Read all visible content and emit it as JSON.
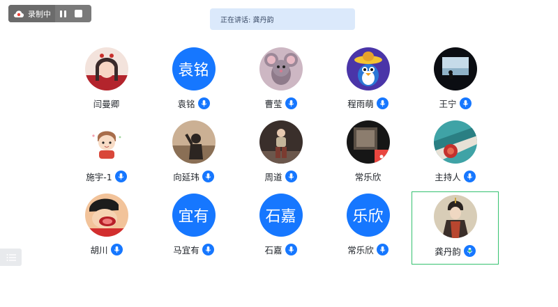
{
  "recording": {
    "label": "录制中",
    "icons": [
      "cloud-record-icon",
      "pause-icon",
      "stop-icon"
    ]
  },
  "speaking": {
    "text": "正在讲话: 龚丹韵"
  },
  "accent_color": "#1677ff",
  "active_border_color": "#34c16f",
  "participants": [
    {
      "name": "闫曼卿",
      "avatar": "photo",
      "mic": false
    },
    {
      "name": "袁铭",
      "avatar_text": "袁铭",
      "avatar": "text",
      "mic": true
    },
    {
      "name": "曹莹",
      "avatar": "photo",
      "mic": true
    },
    {
      "name": "程雨萌",
      "avatar": "photo",
      "mic": true
    },
    {
      "name": "王宁",
      "avatar": "photo",
      "mic": true
    },
    {
      "name": "施宇-1",
      "avatar": "photo",
      "mic": true
    },
    {
      "name": "向延玮",
      "avatar": "photo",
      "mic": true
    },
    {
      "name": "周道",
      "avatar": "photo",
      "mic": true
    },
    {
      "name": "常乐欣",
      "avatar": "photo",
      "mic": false
    },
    {
      "name": "主持人",
      "avatar": "photo",
      "mic": true
    },
    {
      "name": "胡川",
      "avatar": "photo",
      "mic": true
    },
    {
      "name": "马宜有",
      "avatar_text": "宜有",
      "avatar": "text",
      "mic": true
    },
    {
      "name": "石嘉",
      "avatar_text": "石嘉",
      "avatar": "text",
      "mic": true
    },
    {
      "name": "常乐欣",
      "avatar_text": "乐欣",
      "avatar": "text",
      "mic": true
    },
    {
      "name": "龚丹韵",
      "avatar": "photo",
      "mic": true,
      "speaking": true
    }
  ]
}
